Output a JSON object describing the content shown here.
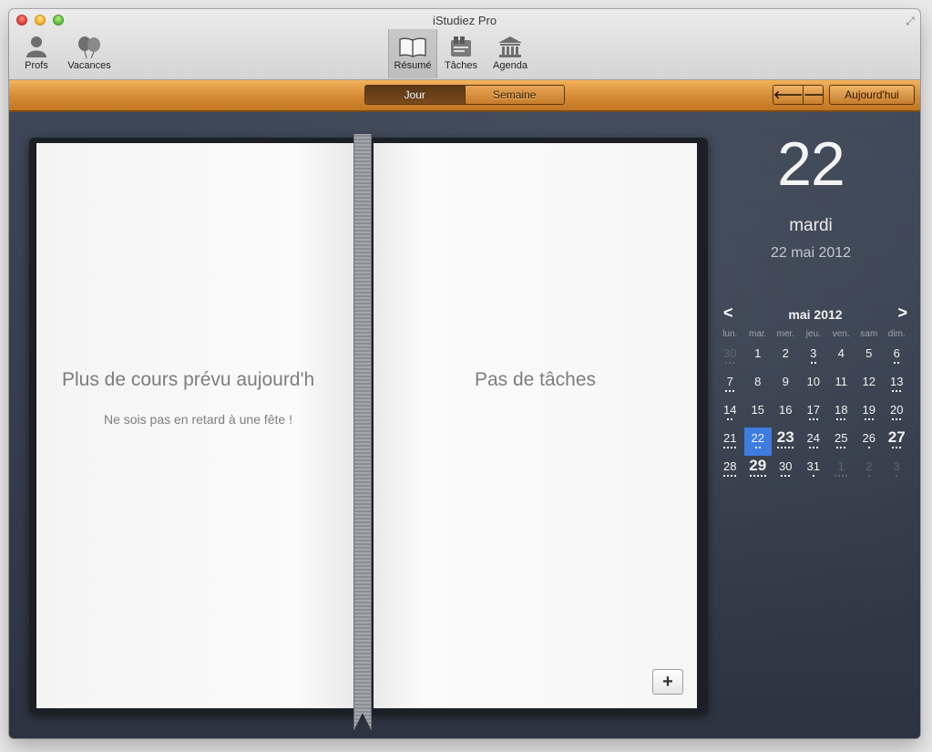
{
  "window": {
    "title": "iStudiez Pro"
  },
  "toolbar": {
    "left": [
      {
        "label": "Profs",
        "icon": "person-icon"
      },
      {
        "label": "Vacances",
        "icon": "balloons-icon"
      }
    ],
    "center": [
      {
        "label": "Résumé",
        "icon": "open-book-icon",
        "active": true
      },
      {
        "label": "Tâches",
        "icon": "tasks-icon",
        "active": false
      },
      {
        "label": "Agenda",
        "icon": "building-icon",
        "active": false
      }
    ]
  },
  "viewbar": {
    "segments": [
      {
        "label": "Jour",
        "active": true
      },
      {
        "label": "Semaine",
        "active": false
      }
    ],
    "prev_glyph": "🡐",
    "next_glyph": "🡒",
    "today_label": "Aujourd'hui"
  },
  "book": {
    "left_title": "Plus de cours prévu aujourd'h",
    "left_subtitle": "Ne sois pas en retard à une fête !",
    "right_title": "Pas de tâches",
    "add_label": "+"
  },
  "date_panel": {
    "day_number": "22",
    "day_name": "mardi",
    "full_date": "22 mai 2012"
  },
  "calendar": {
    "month": "mai 2012",
    "prev": "<",
    "next": ">",
    "weekdays": [
      "lun.",
      "mar.",
      "mer.",
      "jeu.",
      "ven.",
      "sam",
      "dim."
    ],
    "weeks": [
      [
        {
          "d": "30",
          "dots": 3,
          "other": true
        },
        {
          "d": "1",
          "dots": 0
        },
        {
          "d": "2",
          "dots": 0
        },
        {
          "d": "3",
          "dots": 2
        },
        {
          "d": "4",
          "dots": 0
        },
        {
          "d": "5",
          "dots": 0
        },
        {
          "d": "6",
          "dots": 2
        }
      ],
      [
        {
          "d": "7",
          "dots": 3
        },
        {
          "d": "8",
          "dots": 0
        },
        {
          "d": "9",
          "dots": 0
        },
        {
          "d": "10",
          "dots": 0
        },
        {
          "d": "11",
          "dots": 0
        },
        {
          "d": "12",
          "dots": 0
        },
        {
          "d": "13",
          "dots": 3
        }
      ],
      [
        {
          "d": "14",
          "dots": 2
        },
        {
          "d": "15",
          "dots": 0
        },
        {
          "d": "16",
          "dots": 0
        },
        {
          "d": "17",
          "dots": 3
        },
        {
          "d": "18",
          "dots": 3
        },
        {
          "d": "19",
          "dots": 3
        },
        {
          "d": "20",
          "dots": 3
        }
      ],
      [
        {
          "d": "21",
          "dots": 4
        },
        {
          "d": "22",
          "dots": 2,
          "selected": true
        },
        {
          "d": "23",
          "dots": 5,
          "bold": true
        },
        {
          "d": "24",
          "dots": 3
        },
        {
          "d": "25",
          "dots": 3
        },
        {
          "d": "26",
          "dots": 1
        },
        {
          "d": "27",
          "dots": 3,
          "bold": true
        }
      ],
      [
        {
          "d": "28",
          "dots": 4
        },
        {
          "d": "29",
          "dots": 5,
          "bold": true
        },
        {
          "d": "30",
          "dots": 3
        },
        {
          "d": "31",
          "dots": 1
        },
        {
          "d": "1",
          "dots": 4,
          "other": true
        },
        {
          "d": "2",
          "dots": 1,
          "other": true
        },
        {
          "d": "3",
          "dots": 1,
          "other": true
        }
      ]
    ]
  }
}
